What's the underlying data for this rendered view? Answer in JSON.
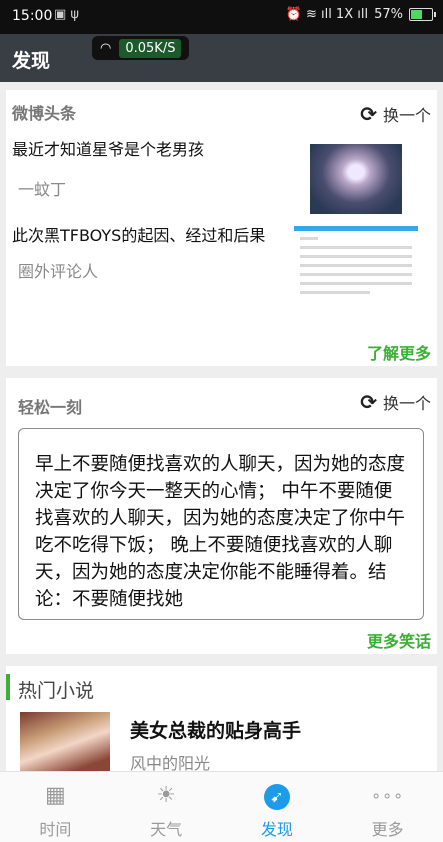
{
  "status_bar": {
    "time": "15:00",
    "left_icons": "▣ ψ",
    "right_icons": "⏰ ≋ ıll 1X ıll",
    "battery": "57%",
    "battery_level": 0.57
  },
  "speed": "0.05K/S",
  "header": {
    "title": "发现"
  },
  "weibo": {
    "label": "微博头条",
    "swap": "换一个",
    "items": [
      {
        "title": "最近才知道星爷是个老男孩",
        "author": "一蚊丁"
      },
      {
        "title": "此次黑TFBOYS的起因、经过和后果",
        "author": "圈外评论人"
      }
    ],
    "more": "了解更多"
  },
  "relax": {
    "label": "轻松一刻",
    "swap": "换一个",
    "joke": "早上不要随便找喜欢的人聊天，因为她的态度决定了你今天一整天的心情； 中午不要随便找喜欢的人聊天，因为她的态度决定了你中午吃不吃得下饭； 晚上不要随便找喜欢的人聊天，因为她的态度决定你能不能睡得着。结论：不要随便找她",
    "more": "更多笑话"
  },
  "novels": {
    "label": "热门小说",
    "book_title": "美女总裁的贴身高手",
    "book_author": "风中的阳光",
    "accent_color": "#3cb035"
  },
  "tabs": [
    {
      "label": "时间",
      "icon": "calendar-icon",
      "glyph": "▦"
    },
    {
      "label": "天气",
      "icon": "sun-icon",
      "glyph": "☀"
    },
    {
      "label": "发现",
      "icon": "compass-icon",
      "glyph": "➹",
      "active": true
    },
    {
      "label": "更多",
      "icon": "more-icon",
      "glyph": "∘∘∘"
    }
  ],
  "colors": {
    "accent_green": "#3cb035",
    "active_blue": "#1e9be8",
    "header_bg": "#393d44"
  }
}
